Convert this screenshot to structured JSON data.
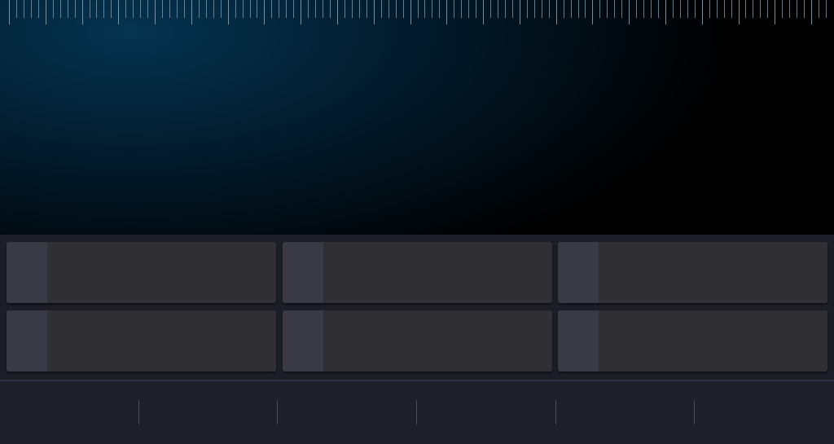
{
  "display": {
    "ruler_tick_count": 113,
    "ruler_major_every": 5,
    "colors": {
      "ruler_tick": "#7d97a8",
      "glow": "#053350",
      "background": "#000000"
    }
  },
  "tiles": [
    {
      "label": ""
    },
    {
      "label": ""
    },
    {
      "label": ""
    },
    {
      "label": ""
    },
    {
      "label": ""
    },
    {
      "label": ""
    }
  ],
  "bottom_bar": {
    "segment_count": 6,
    "segments": [
      {
        "label": ""
      },
      {
        "label": ""
      },
      {
        "label": ""
      },
      {
        "label": ""
      },
      {
        "label": ""
      },
      {
        "label": ""
      }
    ]
  },
  "colors": {
    "tile_background": "#303034",
    "tile_accent": "#3a3a47",
    "panel_background": "#1c1e27",
    "divider": "#4a4c5a"
  }
}
